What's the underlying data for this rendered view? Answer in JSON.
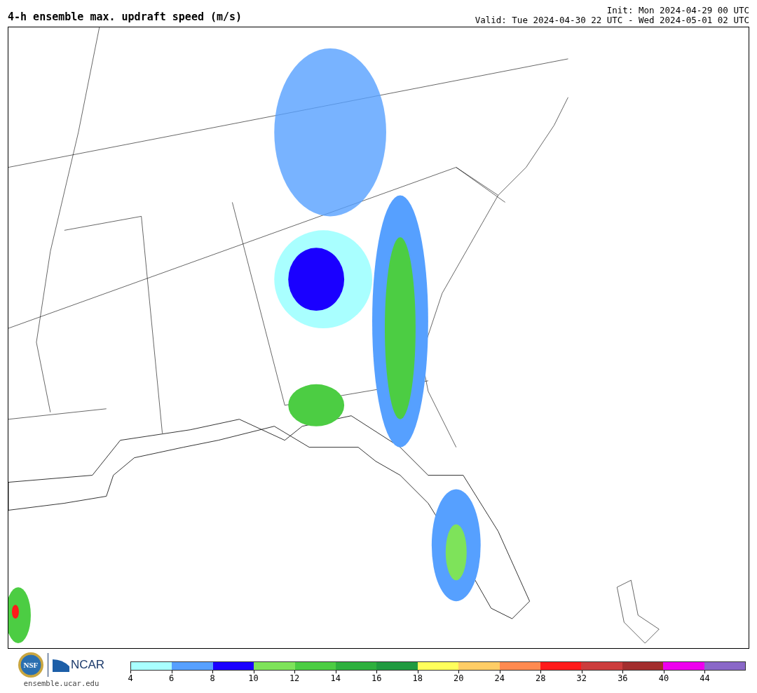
{
  "title": "4-h ensemble max. updraft speed (m/s)",
  "init": "Init: Mon 2024-04-29 00 UTC",
  "valid": "Valid: Tue 2024-04-30 22 UTC - Wed 2024-05-01 02 UTC",
  "logos": {
    "seal_text": "NSF",
    "brand_text": "NCAR",
    "website": "ensemble.ucar.edu"
  },
  "colorbar": {
    "segments": [
      {
        "color": "#a9ffff"
      },
      {
        "color": "#56a0ff"
      },
      {
        "color": "#1a00ff"
      },
      {
        "color": "#7ee35a"
      },
      {
        "color": "#4ccd43"
      },
      {
        "color": "#2eb03e"
      },
      {
        "color": "#209a40"
      },
      {
        "color": "#ffff5c"
      },
      {
        "color": "#ffcd66"
      },
      {
        "color": "#ff8a50"
      },
      {
        "color": "#ff1a1a"
      },
      {
        "color": "#cc3d3d"
      },
      {
        "color": "#a32e2e"
      },
      {
        "color": "#ee00ee"
      },
      {
        "color": "#8a68c8"
      }
    ],
    "ticks": [
      "4",
      "6",
      "8",
      "10",
      "12",
      "14",
      "16",
      "18",
      "20",
      "24",
      "28",
      "32",
      "36",
      "40",
      "44"
    ]
  }
}
